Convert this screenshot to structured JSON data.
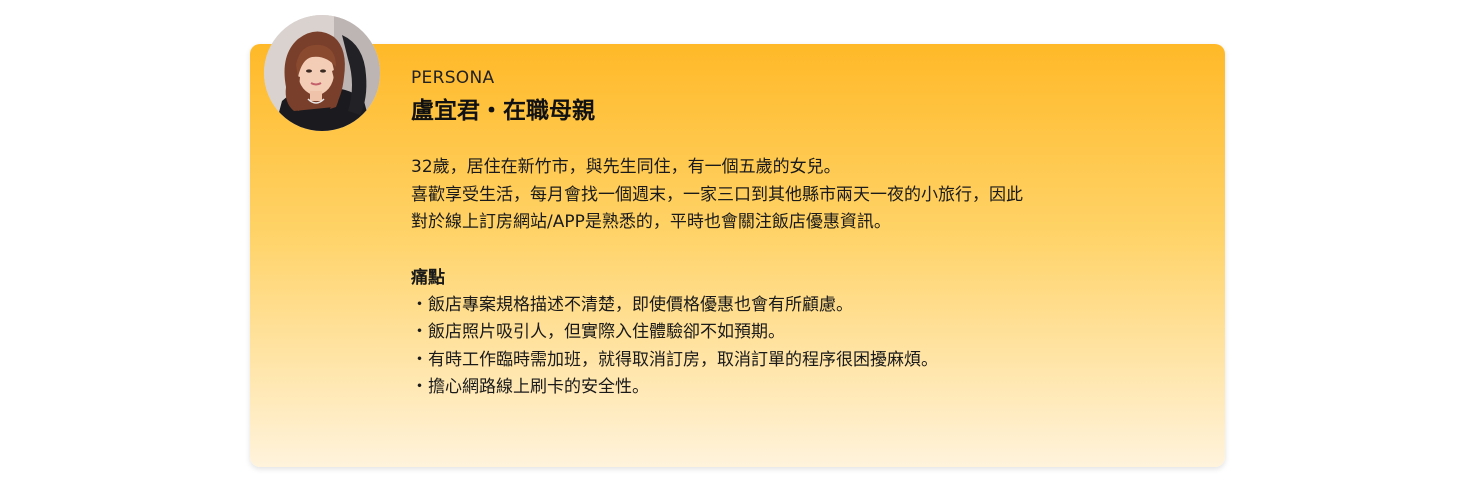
{
  "persona": {
    "label": "PERSONA",
    "title": "盧宜君・在職母親",
    "bio": [
      "32歲，居住在新竹市，與先生同住，有一個五歲的女兒。",
      "喜歡享受生活，每月會找一個週末，一家三口到其他縣市兩天一夜的小旅行，因此",
      "對於線上訂房網站/APP是熟悉的，平時也會關注飯店優惠資訊。"
    ],
    "pain_title": "痛點",
    "pain_points": [
      "・飯店專案規格描述不清楚，即使價格優惠也會有所顧慮。",
      "・飯店照片吸引人，但實際入住體驗卻不如預期。",
      "・有時工作臨時需加班，就得取消訂房，取消訂單的程序很困擾麻煩。",
      "・擔心網路線上刷卡的安全性。"
    ]
  },
  "colors": {
    "card_top": "#ffb928",
    "card_bottom": "#fff3dc"
  }
}
